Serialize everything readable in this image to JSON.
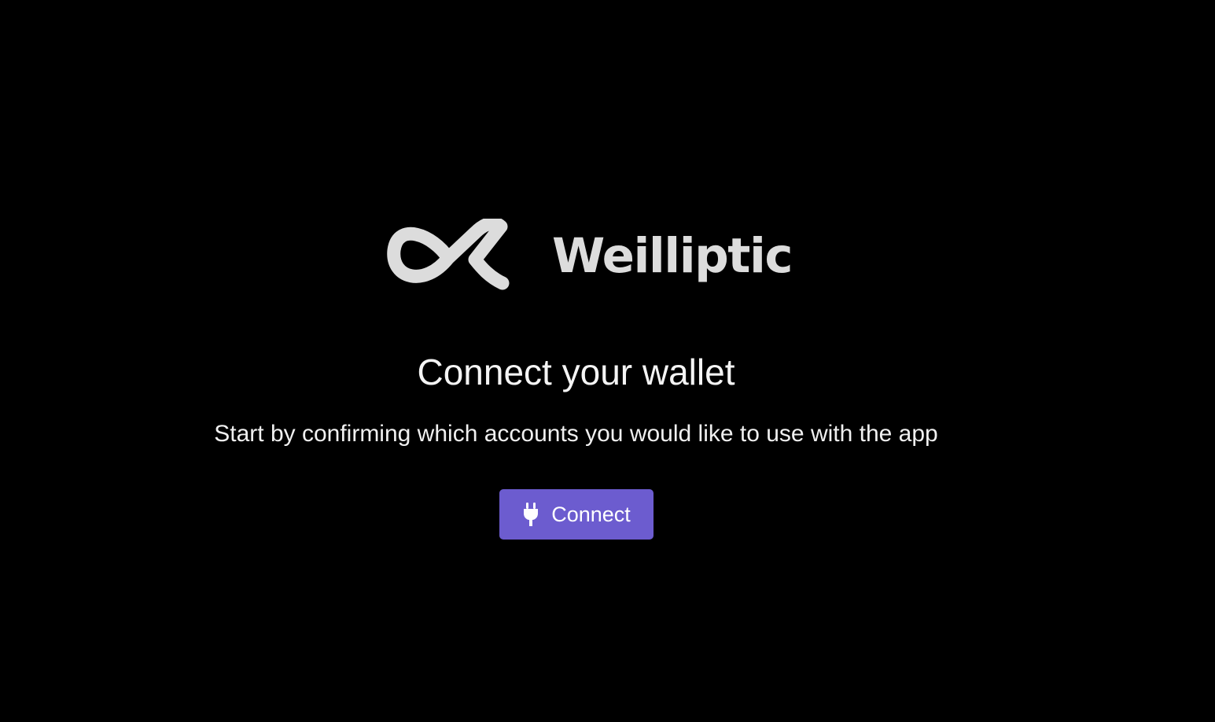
{
  "brand": {
    "name": "Weilliptic",
    "logo_icon": "ok-loop-logo-icon",
    "logo_color": "#dcdcdc"
  },
  "main": {
    "title": "Connect your wallet",
    "subtitle": "Start by confirming which accounts you would like to use with the app",
    "connect_button": {
      "label": "Connect",
      "icon": "plug-icon",
      "color": "#6c5ccf"
    }
  }
}
